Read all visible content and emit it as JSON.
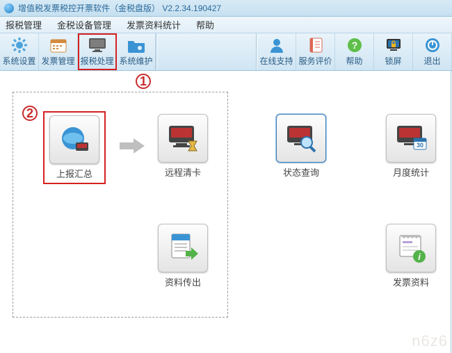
{
  "title": "增值税发票税控开票软件（金税盘版） V2.2.34.190427",
  "menu": {
    "items": [
      "报税管理",
      "金税设备管理",
      "发票资料统计",
      "帮助"
    ]
  },
  "toolbar": {
    "left": [
      {
        "key": "system",
        "label": "系统设置"
      },
      {
        "key": "invoice",
        "label": "发票管理"
      },
      {
        "key": "tax",
        "label": "报税处理"
      },
      {
        "key": "maint",
        "label": "系统维护"
      }
    ],
    "right": [
      {
        "key": "online",
        "label": "在线支持"
      },
      {
        "key": "rating",
        "label": "服务评价"
      },
      {
        "key": "help",
        "label": "帮助"
      },
      {
        "key": "lock",
        "label": "锁屏"
      },
      {
        "key": "exit",
        "label": "退出"
      }
    ]
  },
  "callouts": {
    "c1": "1",
    "c2": "2"
  },
  "modules": {
    "upload": "上报汇总",
    "remote": "远程清卡",
    "status": "状态查询",
    "month": "月度统计",
    "export": "资料传出",
    "invoice": "发票资料"
  },
  "watermark": "n6z6"
}
